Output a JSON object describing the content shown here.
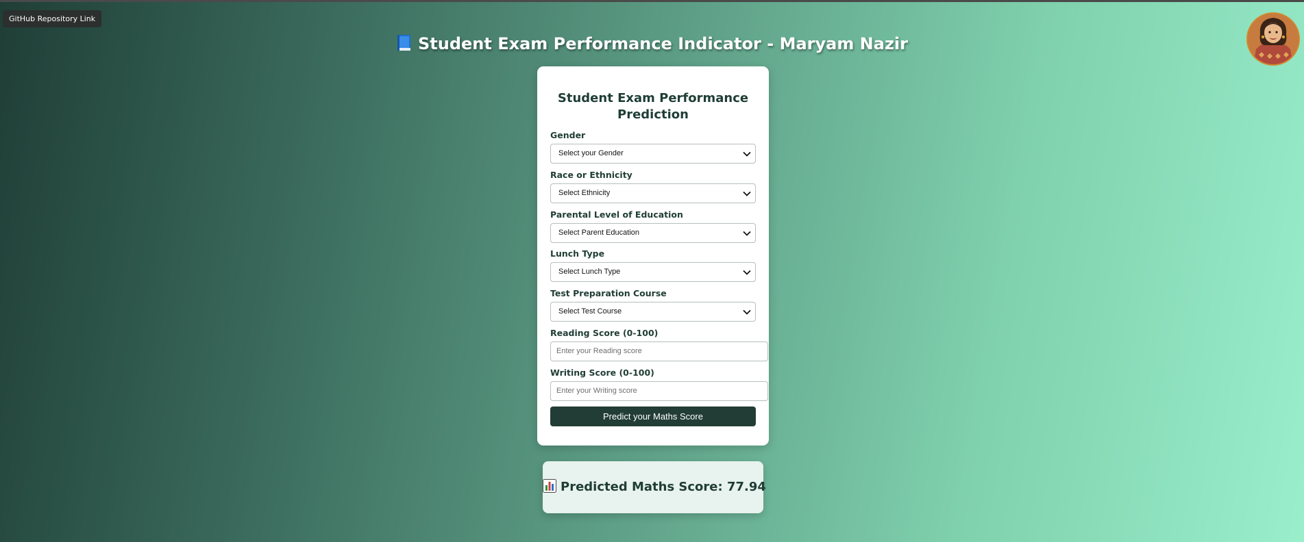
{
  "header": {
    "github_link_label": "GitHub Repository Link",
    "title": "Student Exam Performance Indicator - Maryam Nazir",
    "title_icon": "book-icon",
    "avatar_icon": "avatar-portrait"
  },
  "form": {
    "title": "Student Exam Performance Prediction",
    "fields": {
      "gender": {
        "label": "Gender",
        "selected": "Select your Gender"
      },
      "ethnicity": {
        "label": "Race or Ethnicity",
        "selected": "Select Ethnicity"
      },
      "parent_education": {
        "label": "Parental Level of Education",
        "selected": "Select Parent Education"
      },
      "lunch": {
        "label": "Lunch Type",
        "selected": "Select Lunch Type"
      },
      "test_course": {
        "label": "Test Preparation Course",
        "selected": "Select Test Course"
      },
      "reading": {
        "label": "Reading Score (0-100)",
        "placeholder": "Enter your Reading score",
        "value": ""
      },
      "writing": {
        "label": "Writing Score (0-100)",
        "placeholder": "Enter your Writing score",
        "value": ""
      }
    },
    "submit_label": "Predict your Maths Score"
  },
  "result": {
    "icon": "bar-chart-icon",
    "text": "Predicted Maths Score: 77.94"
  },
  "colors": {
    "accent_dark": "#223d35",
    "gradient_start": "#1f3e36",
    "gradient_end": "#9aeecb"
  }
}
